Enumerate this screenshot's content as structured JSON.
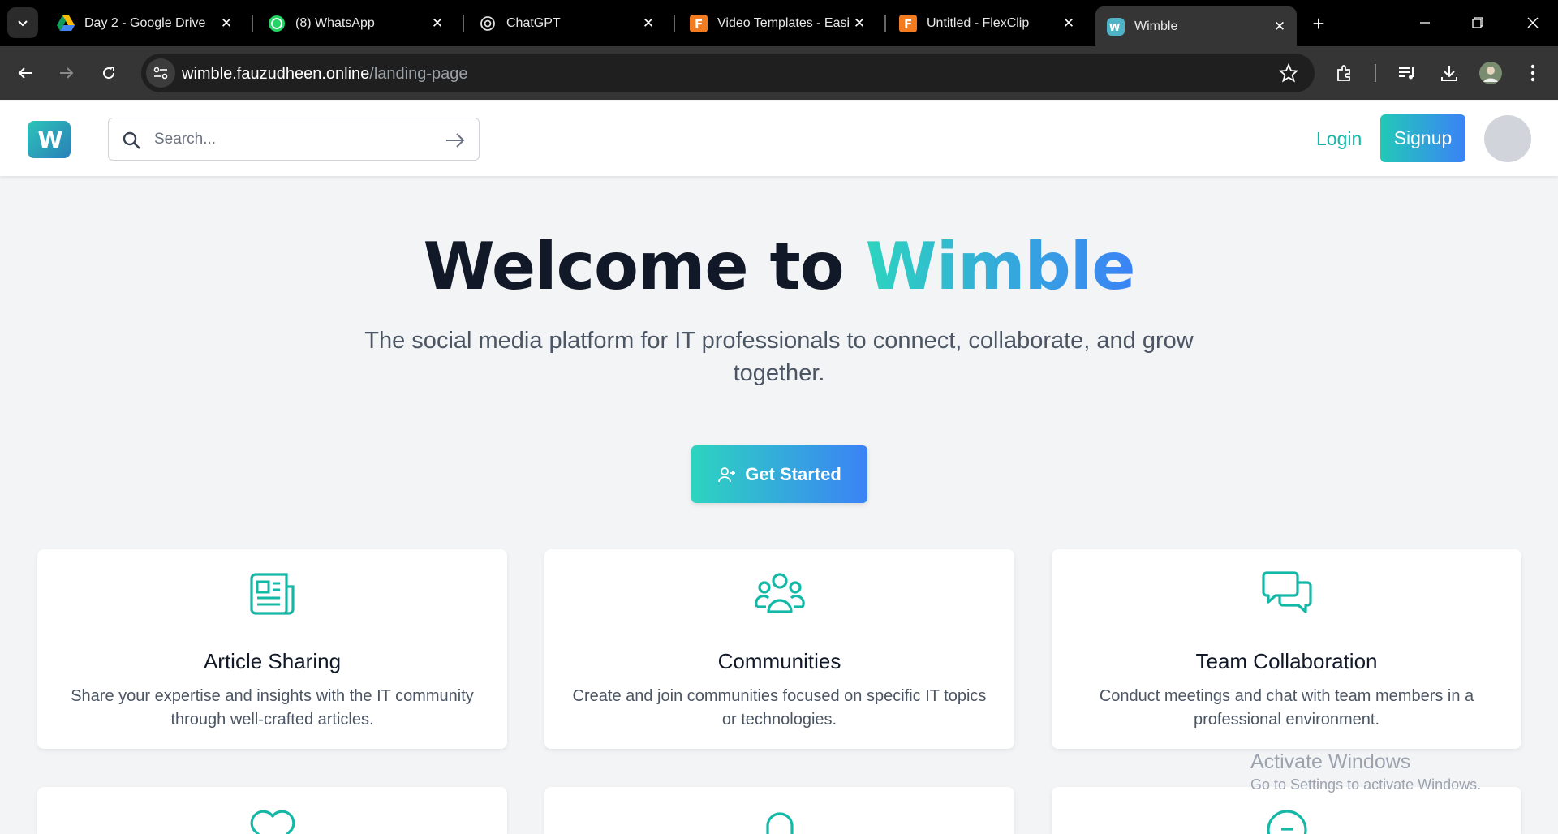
{
  "browser": {
    "tabs": [
      {
        "title": "Day 2 - Google Drive",
        "icon": "google-drive-icon",
        "active": false
      },
      {
        "title": "(8) WhatsApp",
        "icon": "whatsapp-icon",
        "active": false
      },
      {
        "title": "ChatGPT",
        "icon": "chatgpt-icon",
        "active": false
      },
      {
        "title": "Video Templates - Easi",
        "icon": "flexclip-icon",
        "active": false
      },
      {
        "title": "Untitled - FlexClip",
        "icon": "flexclip-icon",
        "active": false
      },
      {
        "title": "Wimble",
        "icon": "wimble-icon",
        "active": true
      }
    ],
    "url_host": "wimble.fauzudheen.online",
    "url_path": "/landing-page"
  },
  "header": {
    "logo_text": "W",
    "search_placeholder": "Search...",
    "login_label": "Login",
    "signup_label": "Signup"
  },
  "hero": {
    "title_prefix": "Welcome to ",
    "title_brand": "Wimble",
    "subtitle": "The social media platform for IT professionals to connect, collaborate, and grow together.",
    "cta_label": "Get Started"
  },
  "features": [
    {
      "title": "Article Sharing",
      "description": "Share your expertise and insights with the IT community through well-crafted articles.",
      "icon": "newspaper-icon"
    },
    {
      "title": "Communities",
      "description": "Create and join communities focused on specific IT topics or technologies.",
      "icon": "users-group-icon"
    },
    {
      "title": "Team Collaboration",
      "description": "Conduct meetings and chat with team members in a professional environment.",
      "icon": "chat-bubbles-icon"
    }
  ],
  "watermark": {
    "line1": "Activate Windows",
    "line2": "Go to Settings to activate Windows."
  },
  "colors": {
    "accent": "#14b8a6",
    "gradient_start": "#2dd4bf",
    "gradient_end": "#3b82f6",
    "page_bg": "#f3f4f6"
  }
}
